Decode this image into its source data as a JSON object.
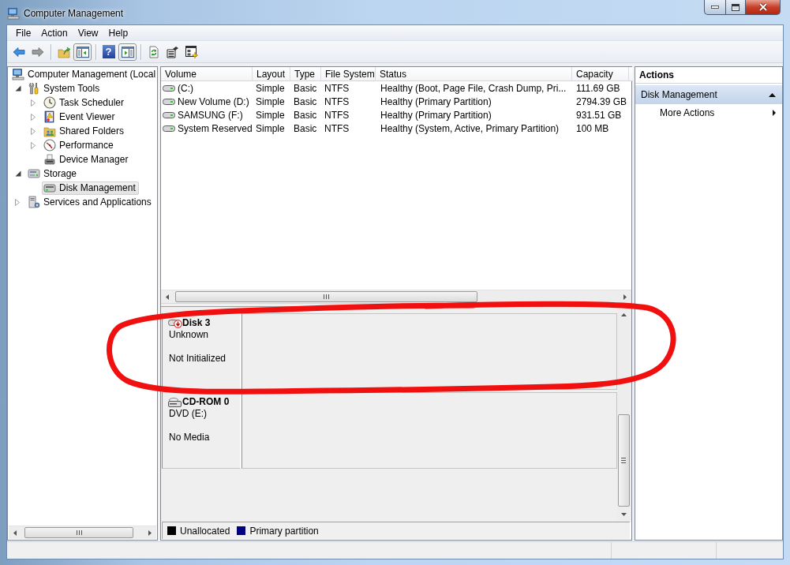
{
  "window": {
    "title": "Computer Management"
  },
  "menu": [
    {
      "label": "File"
    },
    {
      "label": "Action"
    },
    {
      "label": "View"
    },
    {
      "label": "Help"
    }
  ],
  "toolbar": [
    [
      {
        "kind": "back",
        "pressed": false,
        "disabled": false
      },
      {
        "kind": "forward",
        "pressed": false,
        "disabled": true
      }
    ],
    [
      {
        "kind": "up",
        "pressed": false,
        "disabled": false
      },
      {
        "kind": "console-tree",
        "pressed": true,
        "disabled": false
      }
    ],
    [
      {
        "kind": "help",
        "label": "?",
        "pressed": false,
        "disabled": false
      },
      {
        "kind": "action-pane",
        "pressed": true,
        "disabled": false
      }
    ],
    [
      {
        "kind": "refresh",
        "pressed": false,
        "disabled": false
      },
      {
        "kind": "export",
        "pressed": false,
        "disabled": false
      },
      {
        "kind": "properties",
        "pressed": false,
        "disabled": false
      }
    ]
  ],
  "tree": [
    {
      "label": "Computer Management (Local",
      "kind": "computer",
      "selected": false,
      "children": [
        {
          "label": "System Tools",
          "kind": "tools",
          "expanded": true,
          "selected": false,
          "children": [
            {
              "label": "Task Scheduler",
              "kind": "clock",
              "expanded": false,
              "selected": false
            },
            {
              "label": "Event Viewer",
              "kind": "event-log",
              "expanded": false,
              "selected": false
            },
            {
              "label": "Shared Folders",
              "kind": "shared-folder",
              "expanded": false,
              "selected": false
            },
            {
              "label": "Performance",
              "kind": "performance",
              "expanded": false,
              "selected": false
            },
            {
              "label": "Device Manager",
              "kind": "device-manager",
              "selected": false
            }
          ]
        },
        {
          "label": "Storage",
          "kind": "storage",
          "expanded": true,
          "selected": false,
          "children": [
            {
              "label": "Disk Management",
              "kind": "disk",
              "selected": true
            }
          ]
        },
        {
          "label": "Services and Applications",
          "kind": "services",
          "expanded": false,
          "selected": false
        }
      ]
    }
  ],
  "volumes": {
    "columns": [
      "Volume",
      "Layout",
      "Type",
      "File System",
      "Status",
      "Capacity"
    ],
    "rows": [
      [
        "(C:)",
        "Simple",
        "Basic",
        "NTFS",
        "Healthy (Boot, Page File, Crash Dump, Pri...",
        "111.69 GB"
      ],
      [
        "New Volume (D:)",
        "Simple",
        "Basic",
        "NTFS",
        "Healthy (Primary Partition)",
        "2794.39 GB"
      ],
      [
        "SAMSUNG (F:)",
        "Simple",
        "Basic",
        "NTFS",
        "Healthy (Primary Partition)",
        "931.51 GB"
      ],
      [
        "System Reserved",
        "Simple",
        "Basic",
        "NTFS",
        "Healthy (System, Active, Primary Partition)",
        "100 MB"
      ]
    ]
  },
  "disks": [
    {
      "kind": "unknown",
      "name": "Disk 3",
      "type": "Unknown",
      "status": "Not Initialized"
    },
    {
      "kind": "cdrom",
      "name": "CD-ROM 0",
      "type": "DVD (E:)",
      "status": "No Media"
    }
  ],
  "legend": [
    {
      "label": "Unallocated",
      "color": "#000000"
    },
    {
      "label": "Primary partition",
      "color": "#000080"
    }
  ],
  "actions": {
    "title": "Actions",
    "sections": [
      {
        "label": "Disk Management",
        "expanded": true,
        "items": [
          {
            "label": "More Actions",
            "submenu": true
          }
        ]
      }
    ]
  },
  "annotations": [
    {
      "kind": "freehand-loop"
    }
  ]
}
